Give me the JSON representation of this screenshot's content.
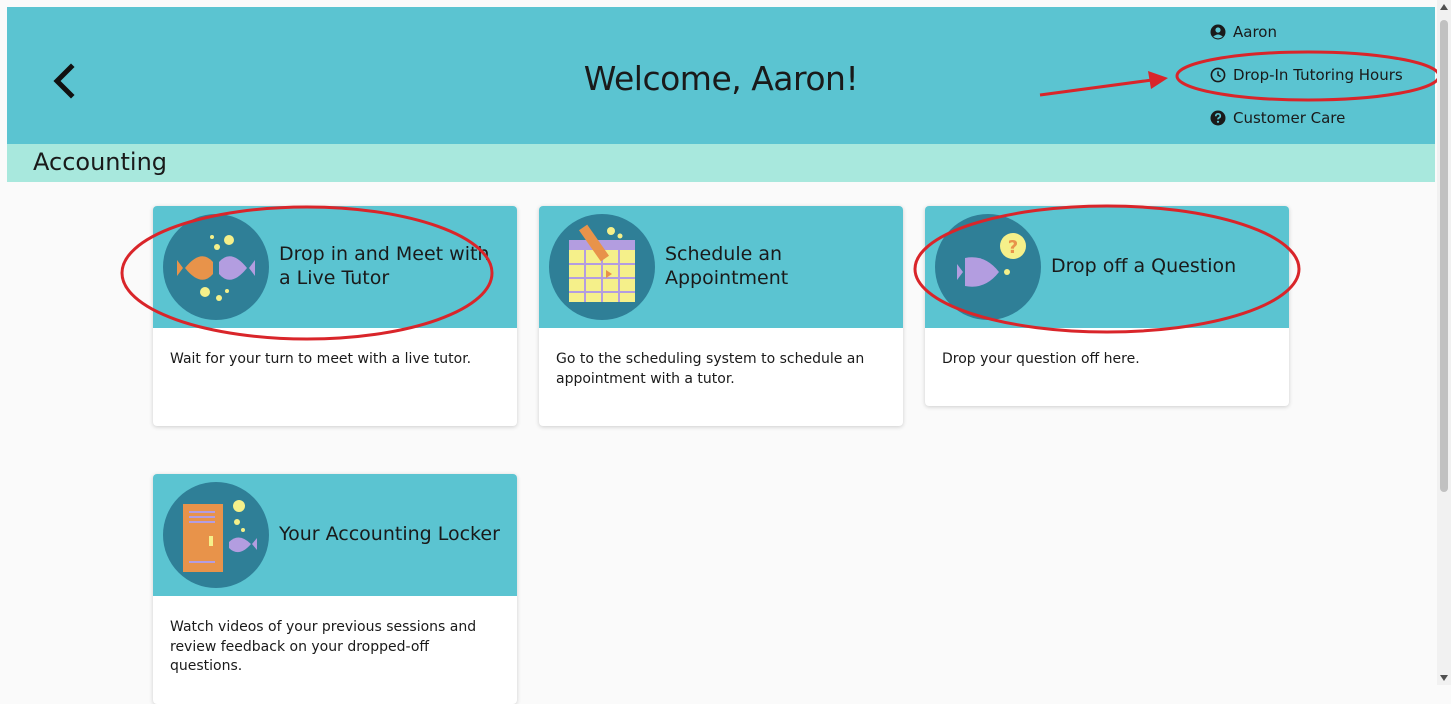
{
  "header": {
    "title": "Welcome, Aaron!",
    "back_icon": "chevron-left-icon",
    "nav": [
      {
        "label": "Aaron",
        "icon": "user-circle-icon"
      },
      {
        "label": "Drop-In Tutoring Hours",
        "icon": "clock-icon"
      },
      {
        "label": "Customer Care",
        "icon": "question-circle-icon"
      }
    ]
  },
  "section": {
    "title": "Accounting"
  },
  "cards": [
    {
      "title": "Drop in and Meet with a Live Tutor",
      "description": "Wait for your turn to meet with a live tutor.",
      "icon": "fish-meet-icon"
    },
    {
      "title": "Schedule an Appointment",
      "description": "Go to the scheduling system to schedule an appointment with a tutor.",
      "icon": "calendar-pencil-icon"
    },
    {
      "title": "Drop off a Question",
      "description": "Drop your question off here.",
      "icon": "fish-question-icon"
    },
    {
      "title": "Your Accounting Locker",
      "description": "Watch videos of your previous sessions and review feedback on your dropped-off questions.",
      "icon": "locker-fish-icon"
    }
  ],
  "colors": {
    "header_bg": "#5bc4d1",
    "subheader_bg": "#a8e8dd",
    "icon_circle": "#2f7f97",
    "annotation_red": "#d9252a"
  }
}
